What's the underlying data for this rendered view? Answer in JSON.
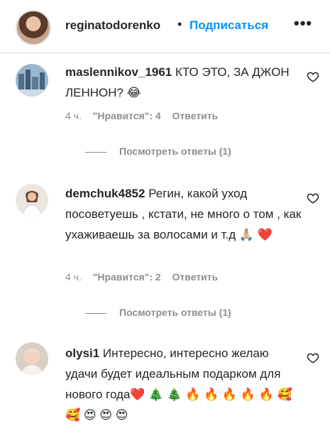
{
  "header": {
    "username": "reginatodorenko",
    "separator": "•",
    "follow_label": "Подписаться",
    "more_label": "•••"
  },
  "comments": [
    {
      "username": "maslennikov_1961",
      "text": " КТО ЭТО, ЗА ДЖОН ЛЕННОН? 😂",
      "time": "4 ч.",
      "likes": "\"Нравится\": 4",
      "reply_label": "Ответить",
      "view_replies": "Посмотреть ответы (1)"
    },
    {
      "username": "demchuk4852",
      "text": " Регин, какой уход посоветуешь , кстати, не много о том , как ухаживаешь за волосами и т.д 🙏🏼 ❤️",
      "time": "4 ч.",
      "likes": "\"Нравится\": 2",
      "reply_label": "Ответить",
      "view_replies": "Посмотреть ответы (1)"
    },
    {
      "username": "olysi1",
      "text": " Интересно, интересно желаю удачи будет идеальным подарком для нового года❤️ 🎄 🎄 🔥 🔥 🔥 🔥 🔥 🥰 🥰 😍 😍 😍"
    }
  ],
  "icons": {
    "heart": "heart-outline-icon",
    "more": "more-options-icon"
  },
  "colors": {
    "accent": "#0095f6",
    "text": "#262626",
    "secondary": "#8e8e8e"
  }
}
